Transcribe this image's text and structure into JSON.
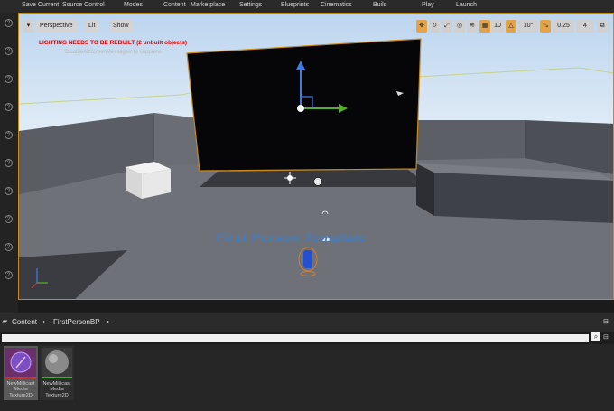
{
  "toolbar": {
    "items": [
      "Save Current",
      "Source Control",
      "Modes",
      "Content",
      "Marketplace",
      "Settings",
      "Blueprints",
      "Cinematics",
      "Build",
      "Play",
      "Launch"
    ]
  },
  "viewport": {
    "perspective_label": "Perspective",
    "lit_label": "Lit",
    "show_label": "Show",
    "grid_snap": "10",
    "rotation_snap": "10°",
    "scale_snap": "0.25",
    "camera_speed": "4",
    "warning_text": "LIGHTING NEEDS TO BE REBUILT (2 unbuilt objects)",
    "hint_text": "'DisableAllScreenMessages' to suppress",
    "floor_text": "First Person Template",
    "accent_color": "#c98a1a"
  },
  "content_browser": {
    "breadcrumb": [
      "Content",
      "FirstPersonBP"
    ],
    "assets": [
      {
        "label": "NewMillicast Media Texture2D",
        "icon": "media-texture-icon"
      },
      {
        "label": "NewMillicast Media Texture2D",
        "icon": "sphere-texture-icon"
      }
    ]
  }
}
